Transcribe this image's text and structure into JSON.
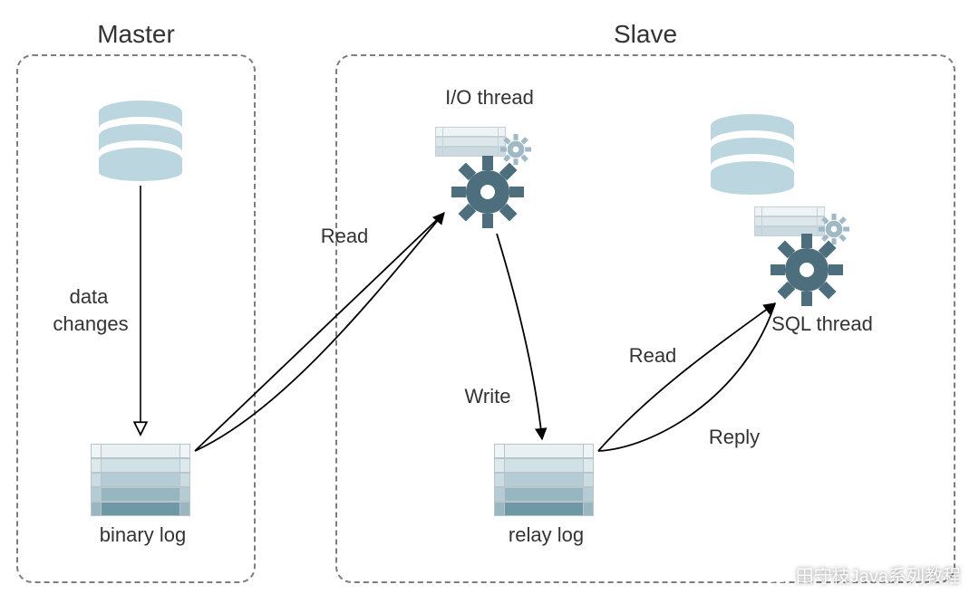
{
  "panels": {
    "master": {
      "title": "Master"
    },
    "slave": {
      "title": "Slave"
    }
  },
  "nodes": {
    "master_db": {
      "kind": "database"
    },
    "slave_db": {
      "kind": "database"
    },
    "binary_log": {
      "label": "binary log"
    },
    "relay_log": {
      "label": "relay log"
    },
    "io_thread": {
      "label": "I/O thread"
    },
    "sql_thread": {
      "label": "SQL thread"
    }
  },
  "edges": {
    "data_changes": {
      "label_line1": "data",
      "label_line2": "changes"
    },
    "read_binlog": {
      "label": "Read"
    },
    "write_relay": {
      "label": "Write"
    },
    "read_relay": {
      "label": "Read"
    },
    "reply": {
      "label": "Reply"
    }
  },
  "colors": {
    "db_fill": "#bcd6df",
    "gear_dark": "#4d6f7d",
    "gear_light": "#9fbac4",
    "panel_border": "#7d7d7d"
  },
  "watermark": {
    "text": "田守枝Java系列教程"
  }
}
